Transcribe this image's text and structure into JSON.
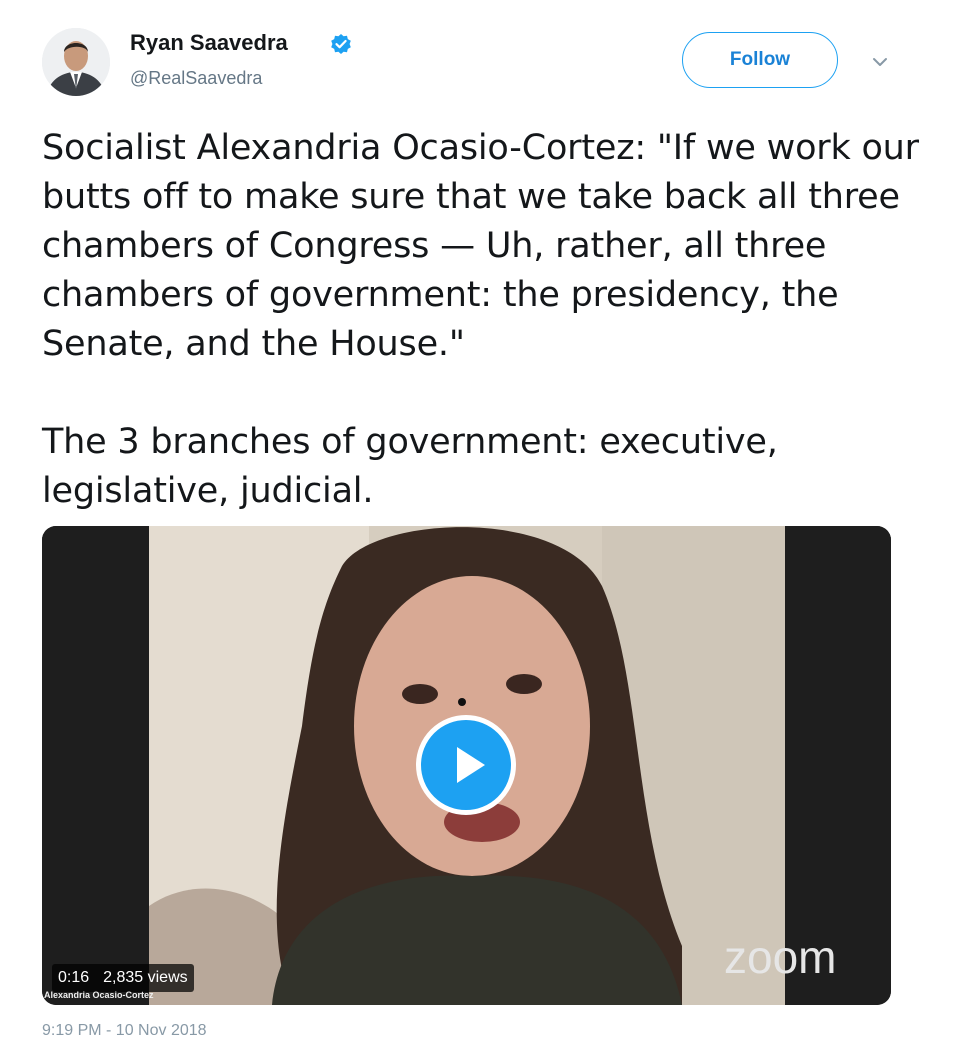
{
  "author": {
    "name": "Ryan Saavedra",
    "handle": "@RealSaavedra",
    "verified": true,
    "verified_icon": "verified-badge-icon",
    "accent_color": "#1da1f2"
  },
  "actions": {
    "follow_label": "Follow",
    "more_icon": "chevron-down-icon"
  },
  "tweet": {
    "paragraph_1": "Socialist Alexandria Ocasio-Cortez: \"If we work our butts off to make sure that we take back all three chambers of Congress — Uh, rather, all three chambers of government: the presidency, the Senate, and the House.\"",
    "paragraph_2": "The 3 branches of government: executive, legislative, judicial."
  },
  "media": {
    "duration": "0:16",
    "views": "2,835 views",
    "watermark": "zoom",
    "caption": "Alexandria Ocasio-Cortez",
    "play_icon": "play-icon"
  },
  "footer": {
    "timestamp": "9:19 PM - 10 Nov 2018"
  }
}
